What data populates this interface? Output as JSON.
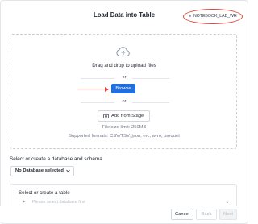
{
  "dialog": {
    "title": "Load Data into Table",
    "warehouse_name": "NOTEBOOK_LAB_WH"
  },
  "upload": {
    "drag_drop_text": "Drag and drop to upload files",
    "or_text_1": "or",
    "browse_label": "Browse",
    "or_text_2": "or",
    "add_from_stage_label": "Add from Stage",
    "file_size_limit": "File size limit: 250MB",
    "supported_formats": "Supported formats: CSV/TSV, json, orc, avro, parquet"
  },
  "database": {
    "section_label": "Select or create a database and schema",
    "selected_value": "No Database selected"
  },
  "table": {
    "section_label": "Select or create a table",
    "placeholder": "Please select database first"
  },
  "footer": {
    "cancel_label": "Cancel",
    "back_label": "Back",
    "next_label": "Next"
  },
  "colors": {
    "primary": "#1f6fe0",
    "annotation": "#e5423d"
  },
  "icons": [
    "cloud-upload-icon",
    "camera-icon",
    "chevron-down-icon",
    "plus-icon",
    "arrow-annotation"
  ]
}
